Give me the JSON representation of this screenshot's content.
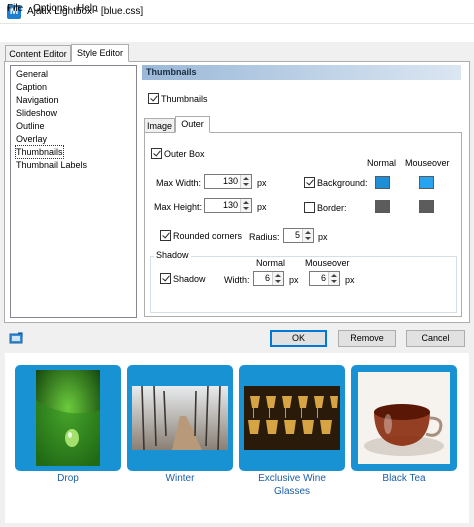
{
  "window": {
    "title": "Ajatix Lightbox - [blue.css]",
    "icon_letter": "M"
  },
  "menu": [
    "File",
    "Options",
    "Help"
  ],
  "main_tabs": [
    "Content Editor",
    "Style Editor"
  ],
  "style_list": [
    "General",
    "Caption",
    "Navigation",
    "Slideshow",
    "Outline",
    "Overlay",
    "Thumbnails",
    "Thumbnail Labels"
  ],
  "selected_item": "Thumbnails",
  "section_title": "Thumbnails",
  "thumbnails_checkbox": {
    "label": "Thumbnails",
    "checked": true
  },
  "inner_tabs": [
    "Image",
    "Outer"
  ],
  "outer": {
    "outer_box": {
      "label": "Outer Box",
      "checked": true
    },
    "col_normal": "Normal",
    "col_mouseover": "Mouseover",
    "max_width": {
      "label": "Max Width:",
      "value": "130",
      "unit": "px"
    },
    "max_height": {
      "label": "Max Height:",
      "value": "130",
      "unit": "px"
    },
    "background": {
      "label": "Background:",
      "checked": true,
      "normal_color": "#1e8fd6",
      "mouseover_color": "#2aa3ee"
    },
    "border": {
      "label": "Border:",
      "checked": false,
      "normal_color": "#5c5c5c",
      "mouseover_color": "#5c5c5c"
    },
    "rounded": {
      "label": "Rounded corners",
      "checked": true,
      "radius_label": "Radius:",
      "radius": "5",
      "unit": "px"
    },
    "shadow": {
      "group_label": "Shadow",
      "label": "Shadow",
      "checked": true,
      "width_label": "Width:",
      "col_normal": "Normal",
      "col_mouseover": "Mouseover",
      "normal": "6",
      "mouseover": "6",
      "unit": "px"
    }
  },
  "buttons": {
    "ok": "OK",
    "remove": "Remove",
    "cancel": "Cancel"
  },
  "gallery": [
    {
      "caption": "Drop",
      "icon": "water-drop-leaf-image"
    },
    {
      "caption": "Winter",
      "icon": "winter-forest-road-image"
    },
    {
      "caption": "Exclusive Wine Glasses",
      "icon": "wine-glasses-image"
    },
    {
      "caption": "Black Tea",
      "icon": "black-tea-cup-image"
    }
  ],
  "colors": {
    "accent": "#1992d4",
    "caption": "#1b5fa6"
  }
}
